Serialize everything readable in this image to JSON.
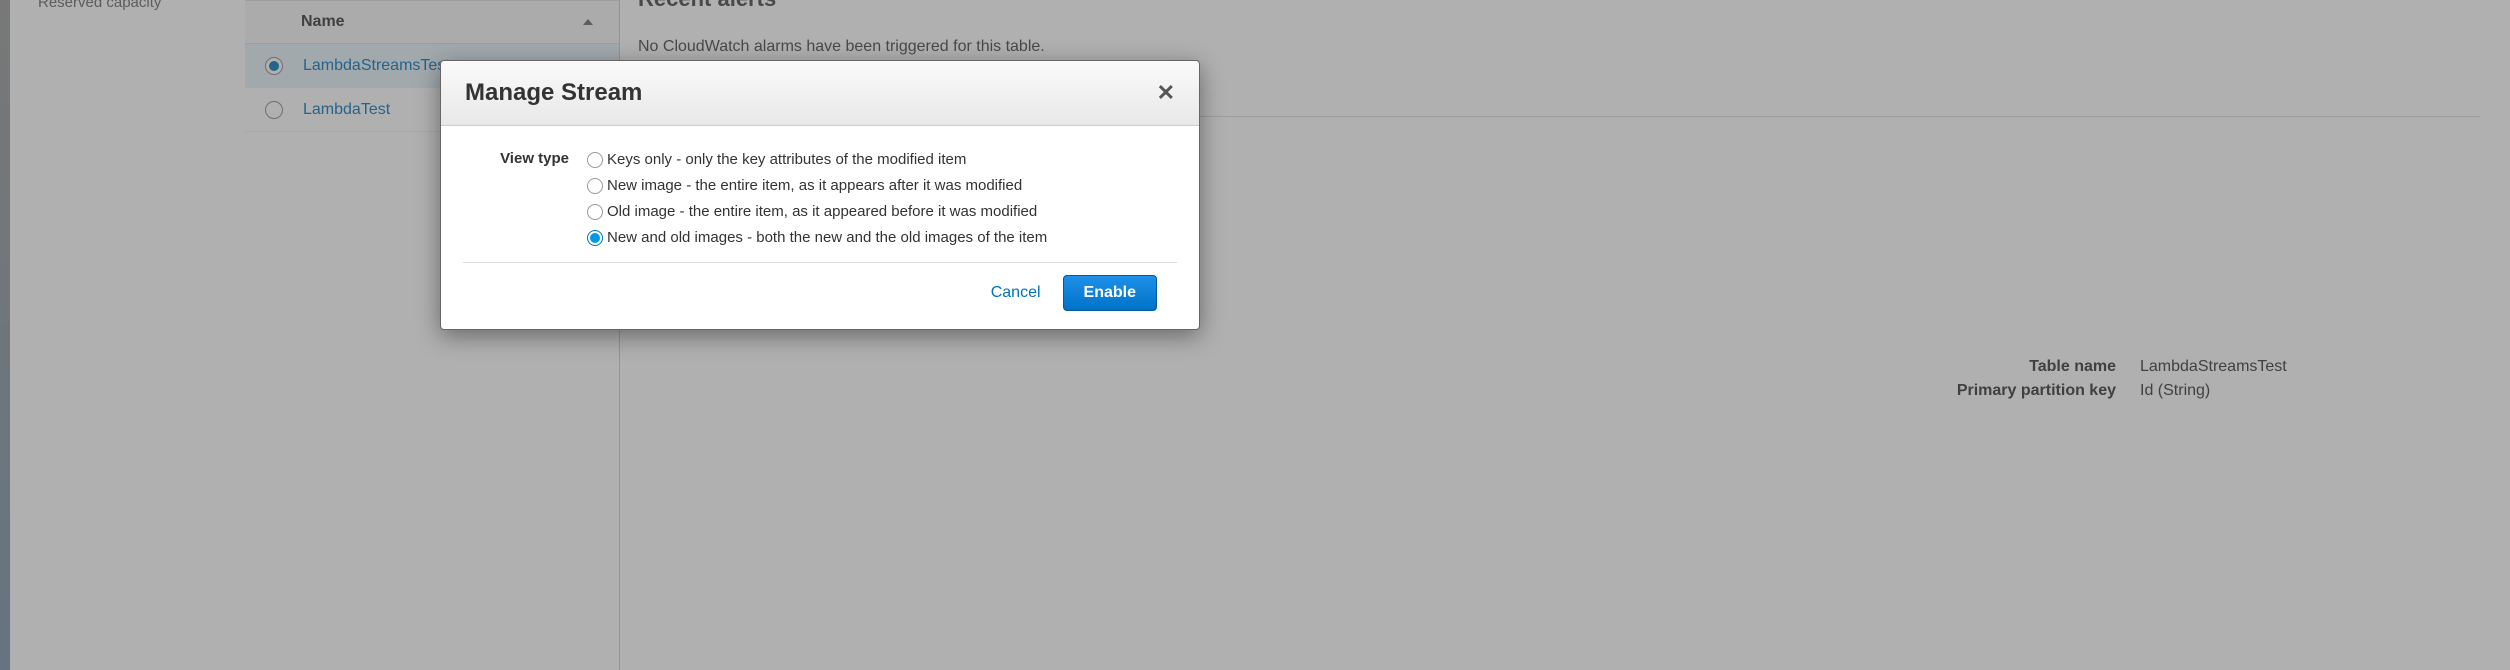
{
  "sidebar": {
    "nav_item": "Reserved capacity"
  },
  "tables_panel": {
    "column_header": "Name",
    "rows": [
      {
        "label": "LambdaStreamsTest",
        "selected": true
      },
      {
        "label": "LambdaTest",
        "selected": false
      }
    ]
  },
  "alerts": {
    "header": "Recent alerts",
    "body": "No CloudWatch alarms have been triggered for this table."
  },
  "details": {
    "rows": [
      {
        "label": "Table name",
        "value": "LambdaStreamsTest"
      },
      {
        "label": "Primary partition key",
        "value": "Id (String)"
      }
    ]
  },
  "modal": {
    "title": "Manage Stream",
    "field_label": "View type",
    "options": [
      {
        "text": "Keys only - only the key attributes of the modified item",
        "selected": false
      },
      {
        "text": "New image - the entire item, as it appears after it was modified",
        "selected": false
      },
      {
        "text": "Old image - the entire item, as it appeared before it was modified",
        "selected": false
      },
      {
        "text": "New and old images - both the new and the old images of the item",
        "selected": true
      }
    ],
    "cancel_label": "Cancel",
    "enable_label": "Enable"
  }
}
